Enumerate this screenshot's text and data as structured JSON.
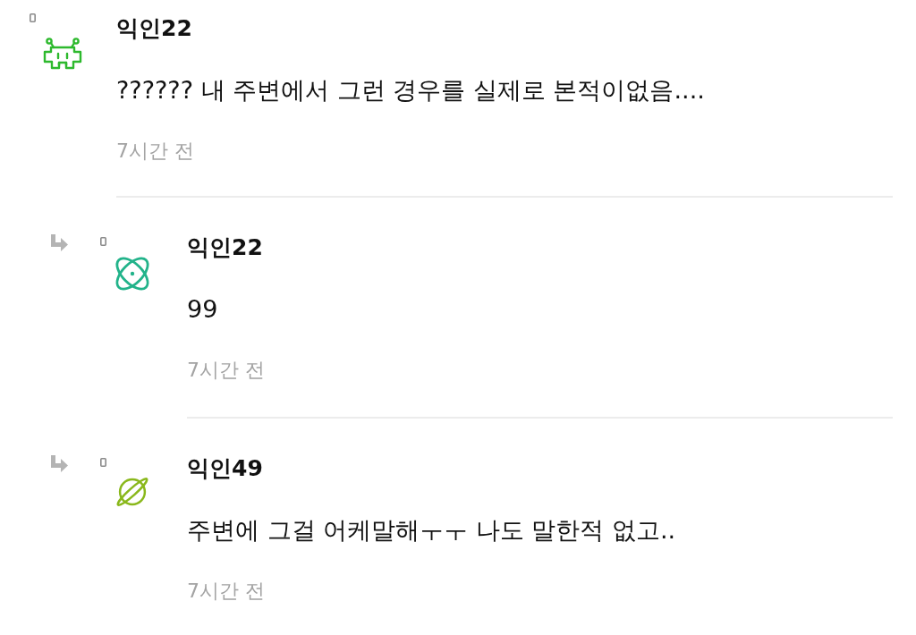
{
  "comments": [
    {
      "author": "익인22",
      "text": "?????? 내 주변에서 그런 경우를 실제로 본적이없음....",
      "time": "7시간 전",
      "avatar": {
        "kind": "invader",
        "color": "#2db92d"
      },
      "children": [
        {
          "author": "익인22",
          "text": "99",
          "time": "7시간 전",
          "avatar": {
            "kind": "atom",
            "color": "#22b38a"
          }
        },
        {
          "author": "익인49",
          "text": "주변에 그걸 어케말해ㅜㅜ 나도 말한적 없고..",
          "time": "7시간 전",
          "avatar": {
            "kind": "planet",
            "color": "#8ab81c"
          }
        }
      ]
    }
  ]
}
